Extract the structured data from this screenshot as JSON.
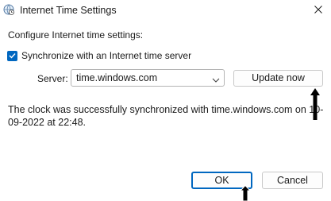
{
  "window": {
    "title": "Internet Time Settings",
    "icons": {
      "app": "clock-globe-icon",
      "close": "close-icon"
    }
  },
  "main": {
    "intro_text": "Configure Internet time settings:",
    "sync_checkbox": {
      "label": "Synchronize with an Internet time server",
      "checked": true
    },
    "server_label": "Server:",
    "server_value": "time.windows.com",
    "update_button": "Update now",
    "status_text": "The clock was successfully synchronized with time.windows.com on 10-09-2022 at 22:48."
  },
  "footer": {
    "ok_label": "OK",
    "cancel_label": "Cancel"
  },
  "colors": {
    "accent": "#0067c0",
    "annotation_arrow": "#000000"
  }
}
